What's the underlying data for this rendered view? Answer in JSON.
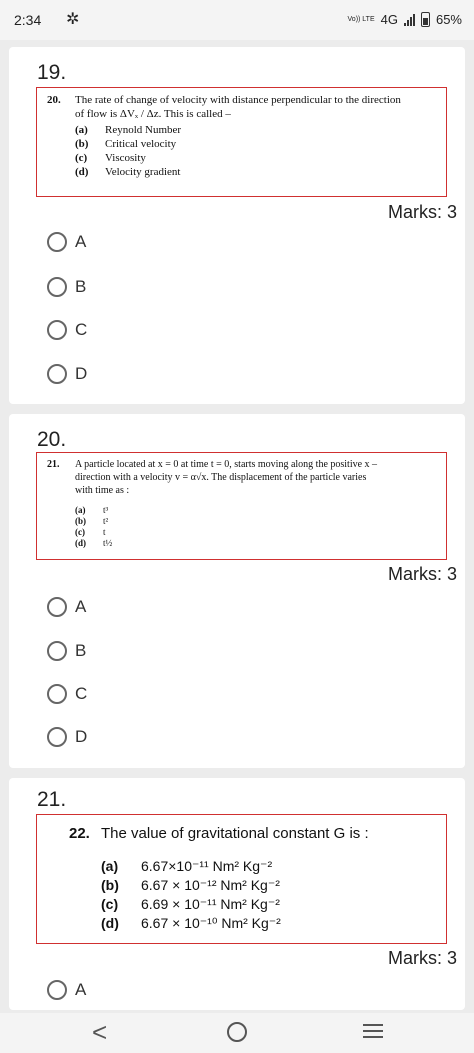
{
  "status": {
    "time": "2:34",
    "volte": "Vo)) LTE",
    "network": "4G",
    "battery": "65%"
  },
  "questions": [
    {
      "number": "19.",
      "q_index": "20.",
      "text_lines": [
        "The rate of change of velocity with distance perpendicular to the direction",
        "of flow is ΔVₓ / Δz. This is called –"
      ],
      "options": [
        {
          "label": "(a)",
          "text": "Reynold Number"
        },
        {
          "label": "(b)",
          "text": "Critical velocity"
        },
        {
          "label": "(c)",
          "text": "Viscosity"
        },
        {
          "label": "(d)",
          "text": "Velocity gradient"
        }
      ],
      "marks": "Marks: 3",
      "choices": [
        "A",
        "B",
        "C",
        "D"
      ]
    },
    {
      "number": "20.",
      "q_index": "21.",
      "text_lines": [
        "A particle located at x = 0 at time t = 0, starts moving along the positive x –",
        "direction with a velocity v = α√x. The displacement of the particle varies",
        "with time as :"
      ],
      "options": [
        {
          "label": "(a)",
          "text": "t³"
        },
        {
          "label": "(b)",
          "text": "t²"
        },
        {
          "label": "(c)",
          "text": "t"
        },
        {
          "label": "(d)",
          "text": "t½"
        }
      ],
      "marks": "Marks: 3",
      "choices": [
        "A",
        "B",
        "C",
        "D"
      ]
    },
    {
      "number": "21.",
      "q_index": "22.",
      "text_lines": [
        "The value of gravitational constant G is :"
      ],
      "options": [
        {
          "label": "(a)",
          "text": "6.67×10⁻¹¹ Nm² Kg⁻²"
        },
        {
          "label": "(b)",
          "text": "6.67 × 10⁻¹² Nm² Kg⁻²"
        },
        {
          "label": "(c)",
          "text": "6.69 × 10⁻¹¹ Nm² Kg⁻²"
        },
        {
          "label": "(d)",
          "text": "6.67 × 10⁻¹⁰ Nm² Kg⁻²"
        }
      ],
      "marks": "Marks: 3",
      "choices": [
        "A"
      ]
    }
  ],
  "nav": {
    "back": "<",
    "home": "○",
    "menu": "≡"
  }
}
